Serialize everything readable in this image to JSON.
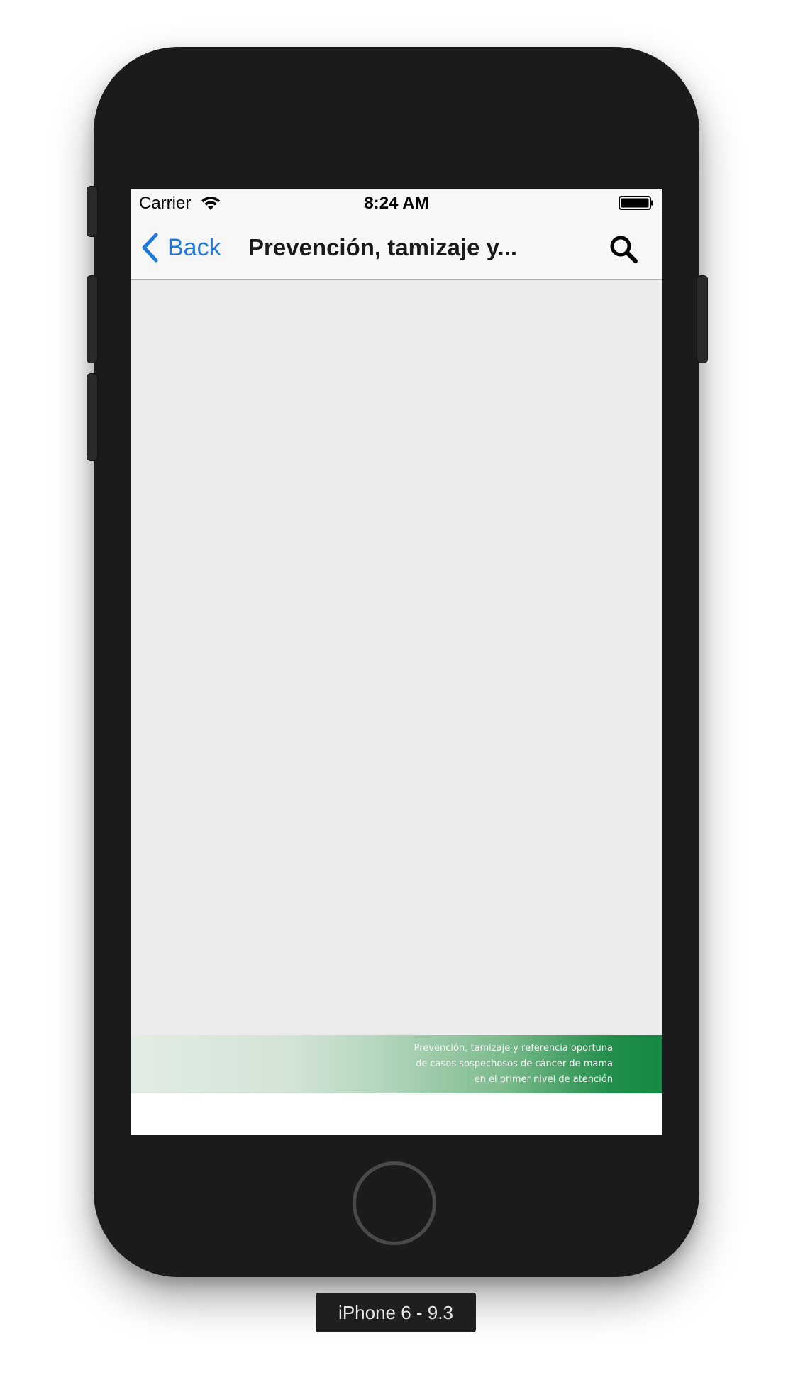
{
  "statusbar": {
    "carrier": "Carrier",
    "time": "8:24 AM",
    "wifi_icon": "wifi-icon",
    "battery_icon": "battery-full-icon"
  },
  "navbar": {
    "back_label": "Back",
    "back_icon": "chevron-left-icon",
    "title": "Prevención, tamizaje y...",
    "search_icon": "search-icon"
  },
  "footer": {
    "lines": [
      "Prevención, tamizaje y referencia oportuna",
      "de casos sospechosos de cáncer de mama",
      "en el primer nivel de atención"
    ]
  },
  "device": {
    "label": "iPhone 6 - 9.3"
  },
  "colors": {
    "accent": "#1f7ae0",
    "banner_green": "#168745",
    "content_bg": "#ececec",
    "bar_bg": "#f7f7f7"
  }
}
